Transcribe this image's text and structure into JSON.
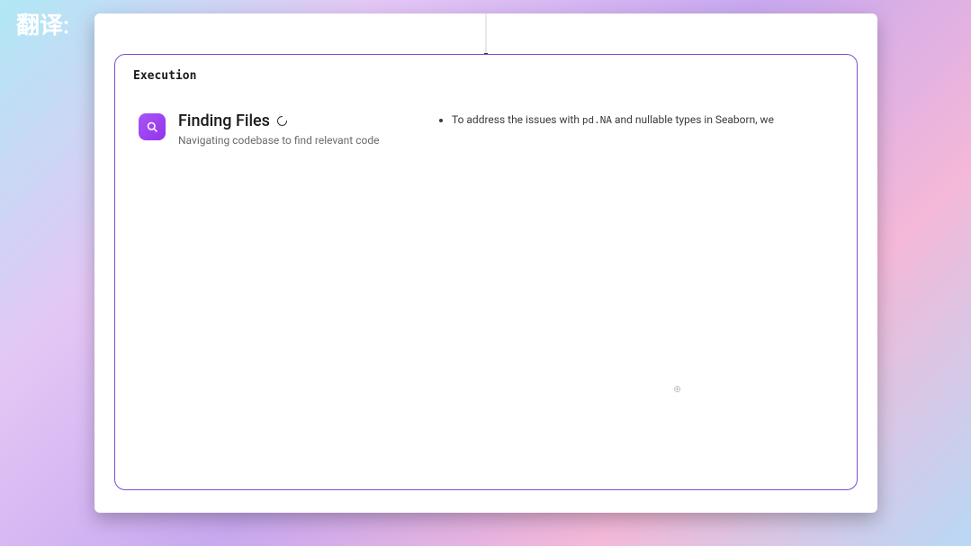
{
  "watermark": "翻译:",
  "panel": {
    "title": "Execution"
  },
  "step": {
    "title": "Finding Files",
    "subtitle": "Navigating codebase to find relevant code"
  },
  "output": {
    "bullet_prefix": "To address the issues with ",
    "code_token": "pd.NA",
    "bullet_suffix": " and nullable types in Seaborn, we"
  }
}
